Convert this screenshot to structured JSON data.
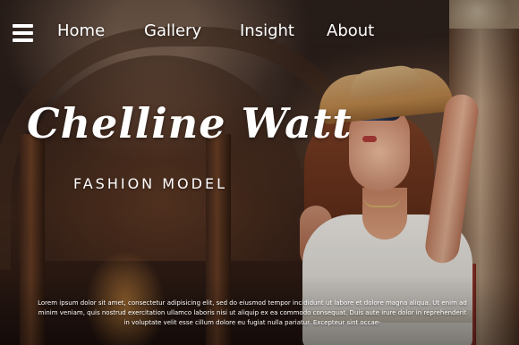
{
  "nav": {
    "items": [
      {
        "label": "Home"
      },
      {
        "label": "Gallery"
      },
      {
        "label": "Insight"
      },
      {
        "label": "About"
      }
    ]
  },
  "hero": {
    "title": "Chelline Watt",
    "subtitle": "FASHION MODEL",
    "description": "Lorem ipsum dolor sit amet, consectetur adipisicing elit, sed do eiusmod tempor incididunt ut labore et dolore magna aliqua. Ut enim ad minim veniam, quis nostrud exercitation ullamco laboris nisi ut aliquip ex ea commodo consequat. Duis aute irure dolor in reprehenderit in voluptate velit esse cillum dolore eu fugiat nulla pariatur. Excepteur sint occae-"
  },
  "icons": {
    "menu": "menu-icon"
  },
  "colors": {
    "text": "#ffffff"
  }
}
